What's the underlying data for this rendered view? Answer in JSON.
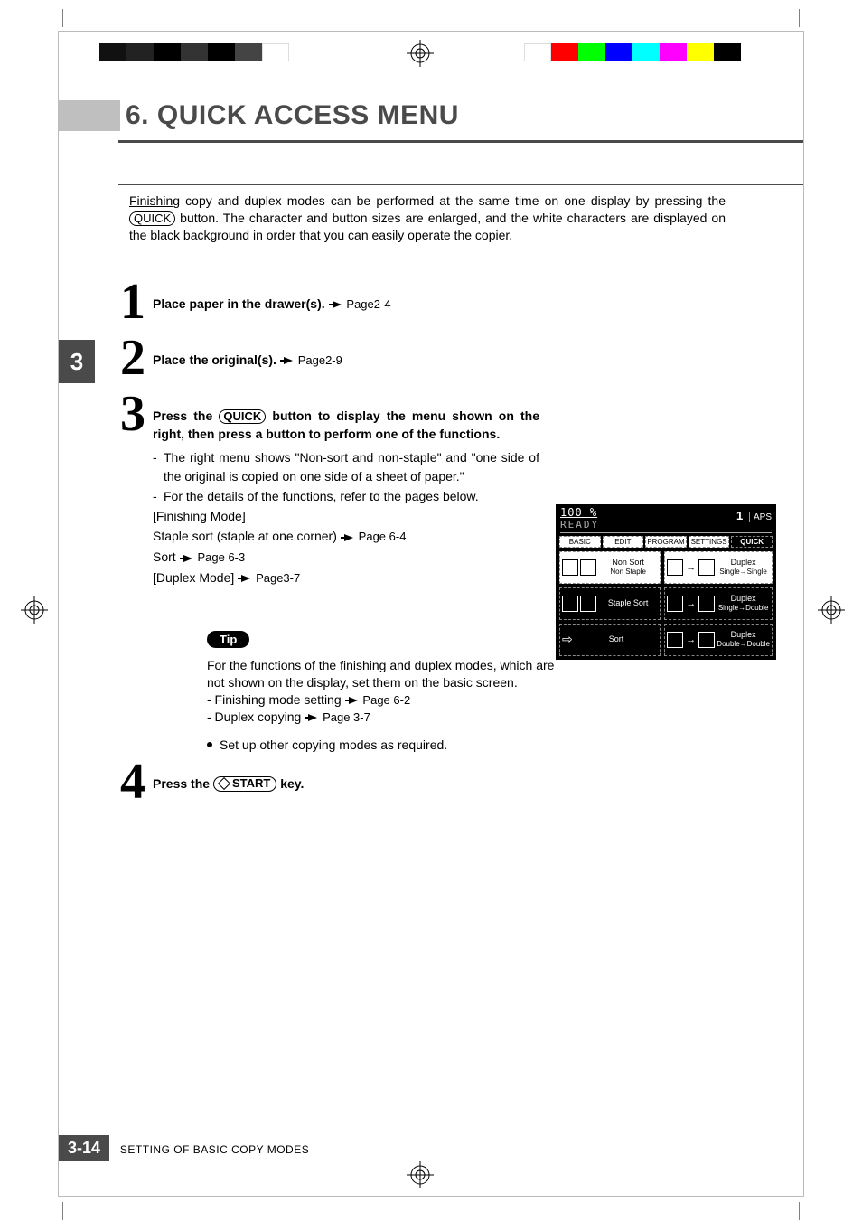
{
  "heading": "6. QUICK ACCESS MENU",
  "intro": {
    "line1_prefix": "Finishing",
    "line1_rest": " copy and duplex modes can be performed at the same time on one display by pressing the ",
    "quick_key": "QUICK",
    "line2": " button. The character and button sizes are enlarged, and the white characters are displayed on the black background in order that you can easily operate the copier."
  },
  "sidebar_chapter": "3",
  "steps": {
    "s1": {
      "num": "1",
      "title": "Place paper in the drawer(s).",
      "ref": "Page2-4"
    },
    "s2": {
      "num": "2",
      "title": "Place the original(s).",
      "ref": "Page2-9"
    },
    "s3": {
      "num": "3",
      "title_before": "Press the ",
      "title_key": "QUICK",
      "title_after": " button to display the menu shown on the right, then press a button to perform one of the functions.",
      "bullet1": "The right menu shows \"Non-sort and non-staple\" and \"one side of the original is copied on one side of a sheet of paper.\"",
      "bullet2": "For the details of the functions, refer to the pages below.",
      "sub1": "[Finishing Mode]",
      "sub2_text": "Staple sort (staple at one corner)",
      "sub2_ref": "Page 6-4",
      "sub3_text": "Sort",
      "sub3_ref": "Page 6-3",
      "sub4_text": "[Duplex Mode]",
      "sub4_ref": "Page3-7"
    },
    "s4": {
      "num": "4",
      "title_before": "Press the ",
      "start_key": "START",
      "title_after": " key."
    }
  },
  "display": {
    "zoom": "100 %",
    "ready": "READY",
    "count": "1",
    "aps": "APS",
    "tabs": [
      "BASIC",
      "EDIT",
      "PROGRAM",
      "SETTINGS",
      "QUICK"
    ],
    "cells": {
      "c1": {
        "line1": "Non Sort",
        "line2": "Non Staple"
      },
      "c2": {
        "line1": "Duplex",
        "line2": "Single→Single"
      },
      "c3": {
        "line1": "Staple Sort"
      },
      "c4": {
        "line1": "Duplex",
        "line2": "Single→Double"
      },
      "c5": {
        "line1": "Sort"
      },
      "c6": {
        "line1": "Duplex",
        "line2": "Double→Double"
      }
    }
  },
  "tip": {
    "label": "Tip",
    "body": "For the functions of the finishing and duplex modes, which are not shown on the display, set them on the basic screen.",
    "item1_text": "- Finishing mode setting",
    "item1_ref": "Page 6-2",
    "item2_text": "- Duplex copying",
    "item2_ref": "Page 3-7",
    "extra": "Set up other copying modes as required."
  },
  "footer": {
    "page": "3-14",
    "section": "SETTING OF BASIC COPY MODES"
  }
}
